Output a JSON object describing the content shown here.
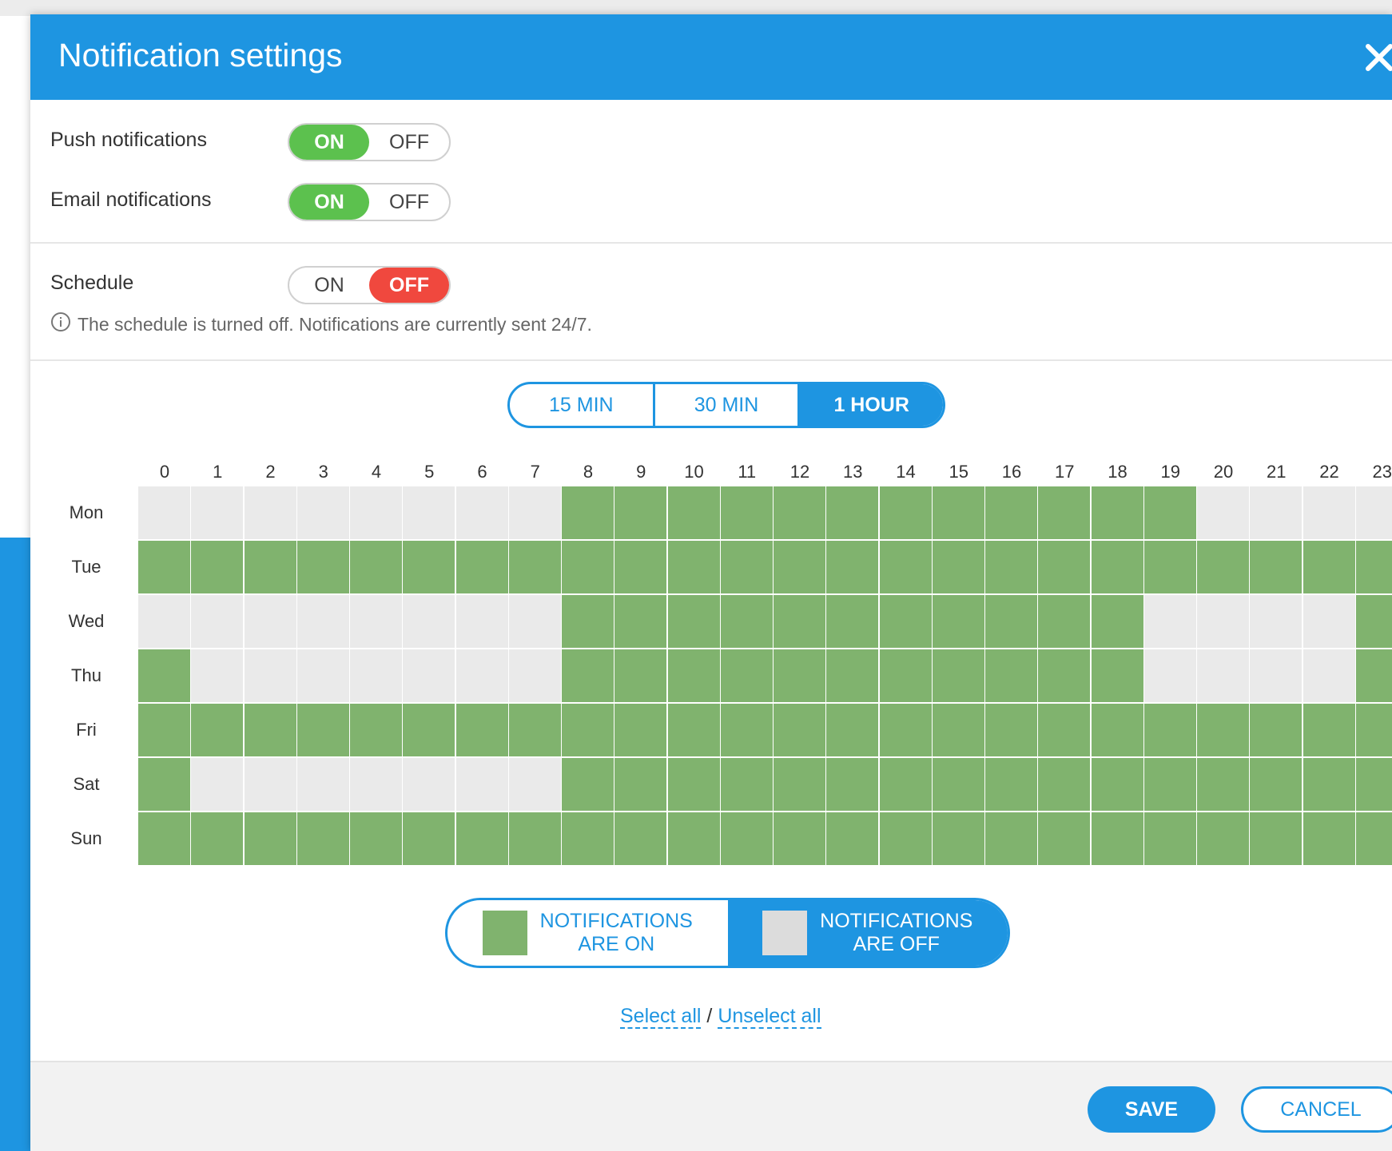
{
  "dialog": {
    "title": "Notification settings"
  },
  "push": {
    "label": "Push notifications",
    "on_label": "ON",
    "off_label": "OFF",
    "value": "on"
  },
  "email": {
    "label": "Email notifications",
    "on_label": "ON",
    "off_label": "OFF",
    "value": "on"
  },
  "schedule": {
    "label": "Schedule",
    "on_label": "ON",
    "off_label": "OFF",
    "value": "off",
    "info": "The schedule is turned off. Notifications are currently sent 24/7."
  },
  "interval": {
    "options": [
      "15 MIN",
      "30 MIN",
      "1 HOUR"
    ],
    "selected": "1 HOUR"
  },
  "grid": {
    "hours": [
      "0",
      "1",
      "2",
      "3",
      "4",
      "5",
      "6",
      "7",
      "8",
      "9",
      "10",
      "11",
      "12",
      "13",
      "14",
      "15",
      "16",
      "17",
      "18",
      "19",
      "20",
      "21",
      "22",
      "23"
    ],
    "days": [
      "Mon",
      "Tue",
      "Wed",
      "Thu",
      "Fri",
      "Sat",
      "Sun"
    ],
    "on_color": "#80b36e",
    "off_color": "#eaeaea",
    "active": [
      [
        8,
        9,
        10,
        11,
        12,
        13,
        14,
        15,
        16,
        17,
        18,
        19
      ],
      [
        0,
        1,
        2,
        3,
        4,
        5,
        6,
        7,
        8,
        9,
        10,
        11,
        12,
        13,
        14,
        15,
        16,
        17,
        18,
        19,
        20,
        21,
        22,
        23
      ],
      [
        8,
        9,
        10,
        11,
        12,
        13,
        14,
        15,
        16,
        17,
        18,
        23
      ],
      [
        0,
        8,
        9,
        10,
        11,
        12,
        13,
        14,
        15,
        16,
        17,
        18,
        23
      ],
      [
        0,
        1,
        2,
        3,
        4,
        5,
        6,
        7,
        8,
        9,
        10,
        11,
        12,
        13,
        14,
        15,
        16,
        17,
        18,
        19,
        20,
        21,
        22,
        23
      ],
      [
        0,
        8,
        9,
        10,
        11,
        12,
        13,
        14,
        15,
        16,
        17,
        18,
        19,
        20,
        21,
        22,
        23
      ],
      [
        0,
        1,
        2,
        3,
        4,
        5,
        6,
        7,
        8,
        9,
        10,
        11,
        12,
        13,
        14,
        15,
        16,
        17,
        18,
        19,
        20,
        21,
        22,
        23
      ]
    ]
  },
  "legend": {
    "on": {
      "line1": "NOTIFICATIONS",
      "line2": "ARE ON"
    },
    "off": {
      "line1": "NOTIFICATIONS",
      "line2": "ARE OFF"
    },
    "selected": "off"
  },
  "links": {
    "select_all": "Select all",
    "separator": "/",
    "unselect_all": "Unselect all"
  },
  "footer": {
    "save": "SAVE",
    "cancel": "CANCEL"
  },
  "colors": {
    "accent": "#1e95e1",
    "on": "#5cc14e",
    "off": "#f0483e"
  }
}
